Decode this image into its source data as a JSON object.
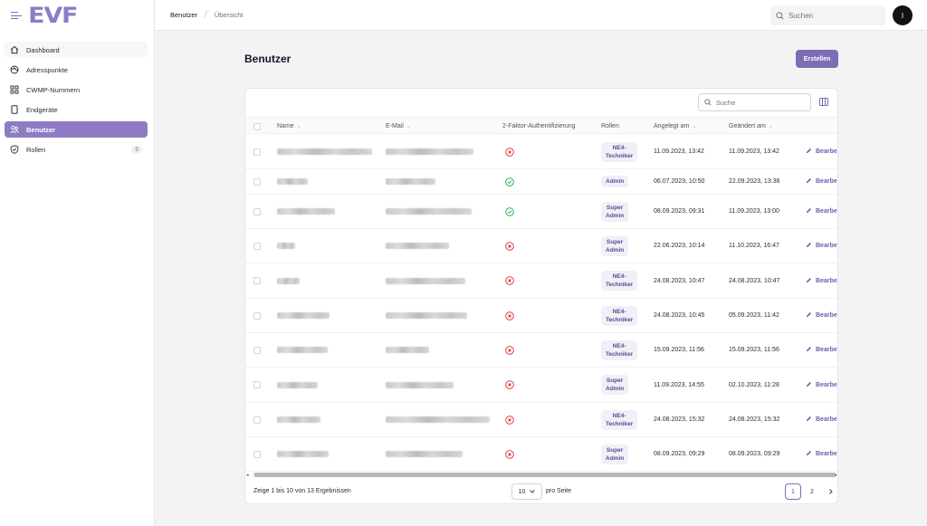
{
  "brand": {
    "logo_text": "EVF",
    "accent": "#8d7cc4"
  },
  "sidebar": {
    "items": [
      {
        "label": "Dashboard",
        "icon": "home-icon",
        "name": "dashboard"
      },
      {
        "label": "Adresspunkte",
        "icon": "globe-icon",
        "name": "adresspunkte"
      },
      {
        "label": "CWMP-Nummern",
        "icon": "grid-icon",
        "name": "cwmp-nummern"
      },
      {
        "label": "Endgeräte",
        "icon": "device-icon",
        "name": "endgeraete"
      },
      {
        "label": "Benutzer",
        "icon": "users-icon",
        "name": "benutzer",
        "active": true
      },
      {
        "label": "Rollen",
        "icon": "shield-check-icon",
        "name": "rollen",
        "badge": "5"
      }
    ]
  },
  "topbar": {
    "breadcrumb": [
      "Benutzer",
      "Übersicht"
    ],
    "search_placeholder": "Suchen",
    "avatar_initial": "I"
  },
  "main": {
    "title": "Benutzer",
    "create_label": "Erstellen"
  },
  "table": {
    "search_placeholder": "Suche",
    "columns": [
      "Name",
      "E-Mail",
      "2-Faktor-Authentifizierung",
      "Rollen",
      "Angelegt am",
      "Geändert am"
    ],
    "edit_label": "Bearbe",
    "rows": [
      {
        "two_factor": false,
        "role": [
          "NE4-",
          "Techniker"
        ],
        "created": "11.09.2023, 13:42",
        "updated": "11.09.2023, 13:42"
      },
      {
        "two_factor": true,
        "role": [
          "Admin"
        ],
        "created": "06.07.2023, 10:50",
        "updated": "22.09.2023, 13:36"
      },
      {
        "two_factor": true,
        "role": [
          "Super",
          "Admin"
        ],
        "created": "08.09.2023, 09:31",
        "updated": "11.09.2023, 13:00"
      },
      {
        "two_factor": false,
        "role": [
          "Super",
          "Admin"
        ],
        "created": "22.06.2023, 10:14",
        "updated": "11.10.2023, 16:47"
      },
      {
        "two_factor": false,
        "role": [
          "NE4-",
          "Techniker"
        ],
        "created": "24.08.2023, 10:47",
        "updated": "24.08.2023, 10:47"
      },
      {
        "two_factor": false,
        "role": [
          "NE4-",
          "Techniker"
        ],
        "created": "24.08.2023, 10:45",
        "updated": "05.09.2023, 11:42"
      },
      {
        "two_factor": false,
        "role": [
          "NE4-",
          "Techniker"
        ],
        "created": "15.09.2023, 11:56",
        "updated": "15.09.2023, 11:56"
      },
      {
        "two_factor": false,
        "role": [
          "Super",
          "Admin"
        ],
        "created": "11.09.2023, 14:55",
        "updated": "02.10.2023, 11:28"
      },
      {
        "two_factor": false,
        "role": [
          "NE4-",
          "Techniker"
        ],
        "created": "24.08.2023, 15:32",
        "updated": "24.08.2023, 15:32"
      },
      {
        "two_factor": false,
        "role": [
          "Super",
          "Admin"
        ],
        "created": "08.09.2023, 09:29",
        "updated": "08.09.2023, 09:29"
      }
    ],
    "footer": {
      "results_text": "Zeige 1 bis 10 von 13 Ergebnissen",
      "per_page_value": "10",
      "per_page_label": "pro Seite",
      "pages": [
        "1",
        "2"
      ],
      "current_page": "1"
    }
  },
  "colors": {
    "accent": "#7e6db4",
    "success": "#16a34a",
    "danger": "#dc2626"
  }
}
